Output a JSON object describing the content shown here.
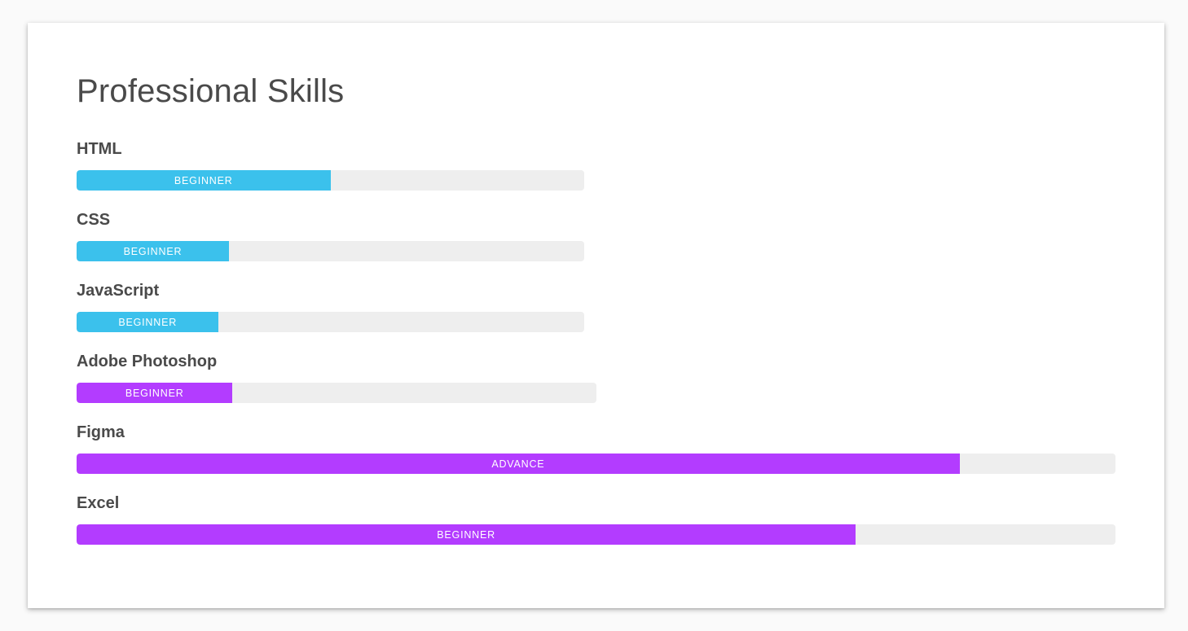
{
  "section": {
    "title": "Professional Skills"
  },
  "colors": {
    "web": "#3bc1ec",
    "design": "#b33cff",
    "track": "#eeeeee"
  },
  "skills": [
    {
      "name": "HTML",
      "level": "BEGINNER",
      "percent": 50,
      "color": "#3bc1ec"
    },
    {
      "name": "CSS",
      "level": "BEGINNER",
      "percent": 30,
      "color": "#3bc1ec"
    },
    {
      "name": "JavaScript",
      "level": "BEGINNER",
      "percent": 28,
      "color": "#3bc1ec"
    },
    {
      "name": "Adobe Photoshop",
      "level": "BEGINNER",
      "percent": 30,
      "color": "#b33cff"
    },
    {
      "name": "Figma",
      "level": "ADVANCE",
      "percent": 85,
      "color": "#b33cff"
    },
    {
      "name": "Excel",
      "level": "BEGINNER",
      "percent": 75,
      "color": "#b33cff"
    }
  ]
}
